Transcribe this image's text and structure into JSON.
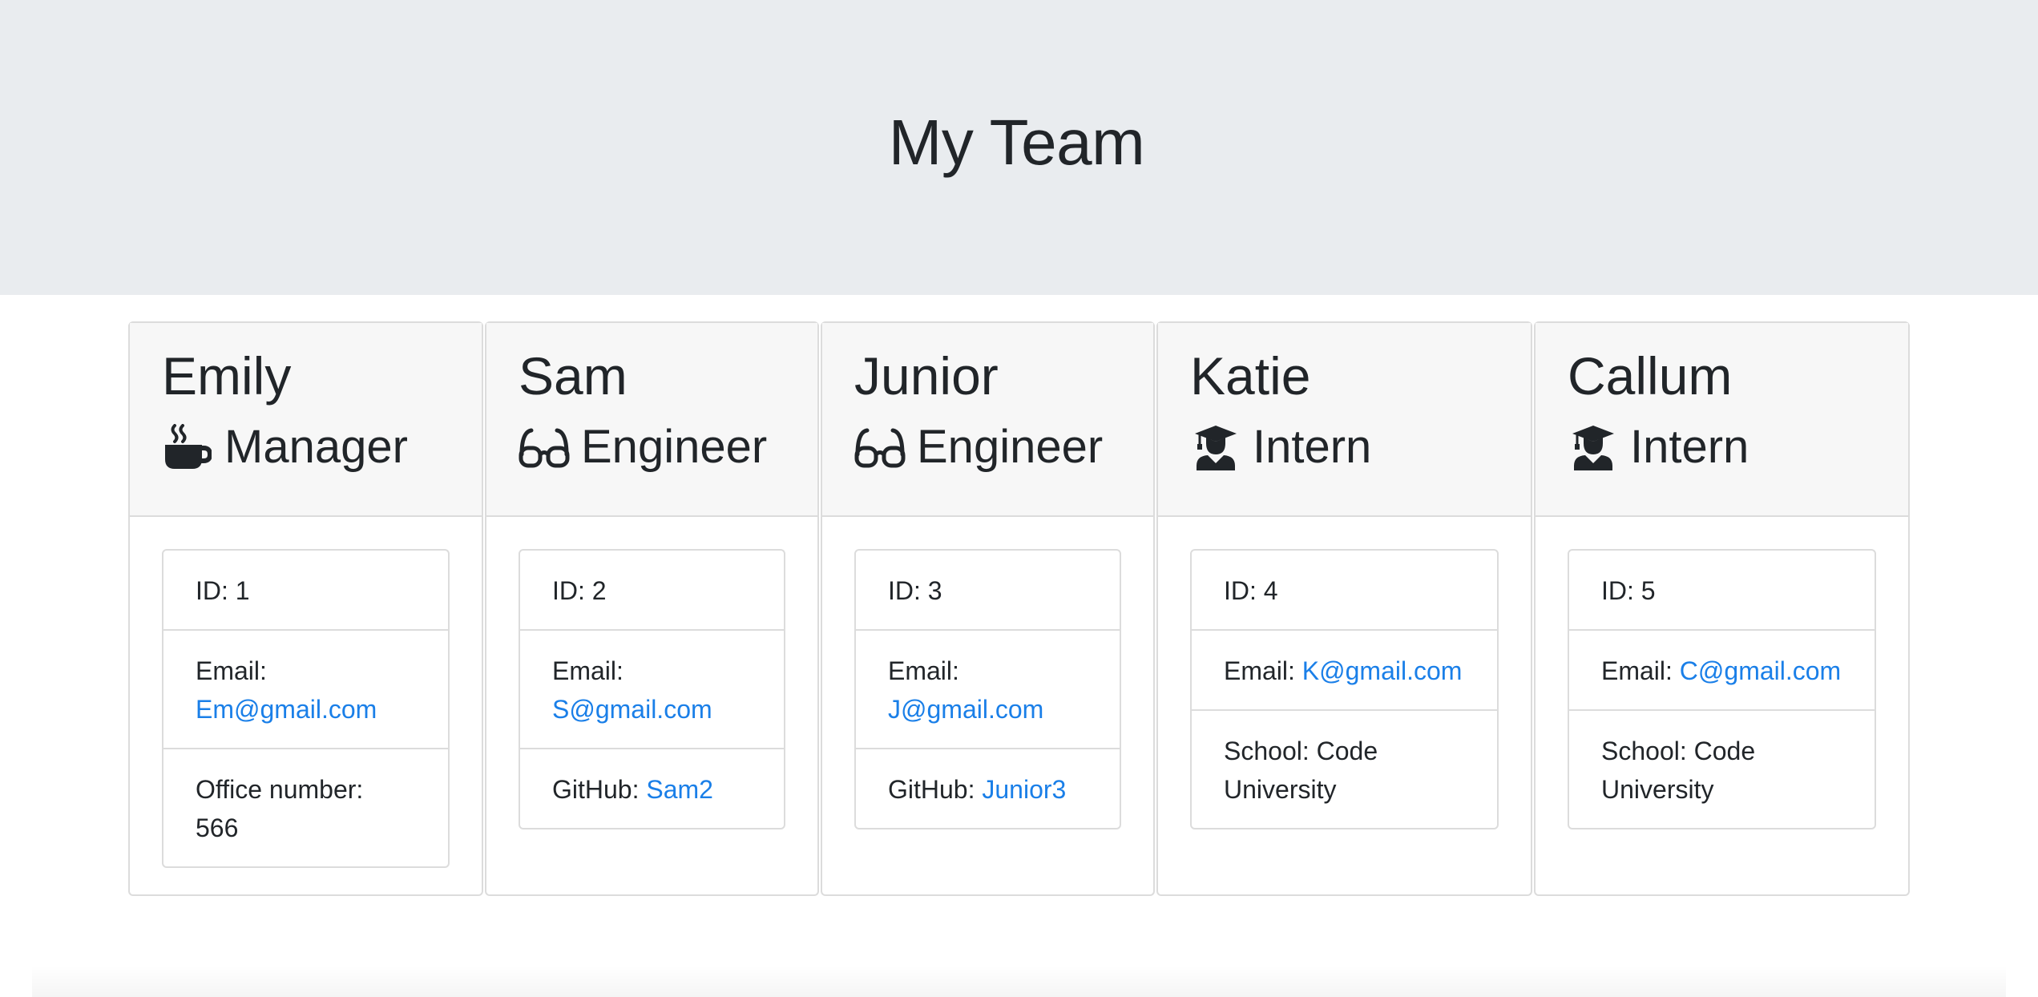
{
  "header": {
    "title": "My Team"
  },
  "members": [
    {
      "name": "Emily",
      "role": "Manager",
      "role_icon": "coffee-icon",
      "id_label": "ID:",
      "id": "1",
      "email_label": "Email:",
      "email": "Em@gmail.com",
      "extra_label": "Office number:",
      "extra_value": "566"
    },
    {
      "name": "Sam",
      "role": "Engineer",
      "role_icon": "glasses-icon",
      "id_label": "ID:",
      "id": "2",
      "email_label": "Email:",
      "email": "S@gmail.com",
      "extra_label": "GitHub:",
      "extra_value": "Sam2"
    },
    {
      "name": "Junior",
      "role": "Engineer",
      "role_icon": "glasses-icon",
      "id_label": "ID:",
      "id": "3",
      "email_label": "Email:",
      "email": "J@gmail.com",
      "extra_label": "GitHub:",
      "extra_value": "Junior3"
    },
    {
      "name": "Katie",
      "role": "Intern",
      "role_icon": "graduate-icon",
      "id_label": "ID:",
      "id": "4",
      "email_label": "Email:",
      "email": "K@gmail.com",
      "extra_label": "School:",
      "extra_value": "Code University"
    },
    {
      "name": "Callum",
      "role": "Intern",
      "role_icon": "graduate-icon",
      "id_label": "ID:",
      "id": "5",
      "email_label": "Email:",
      "email": "C@gmail.com",
      "extra_label": "School:",
      "extra_value": "Code University"
    }
  ],
  "colors": {
    "header_bg": "#e9ecef",
    "card_header_bg": "#f7f7f7",
    "link": "#1a7fe8",
    "text": "#212529",
    "border": "#dcdcdc"
  }
}
